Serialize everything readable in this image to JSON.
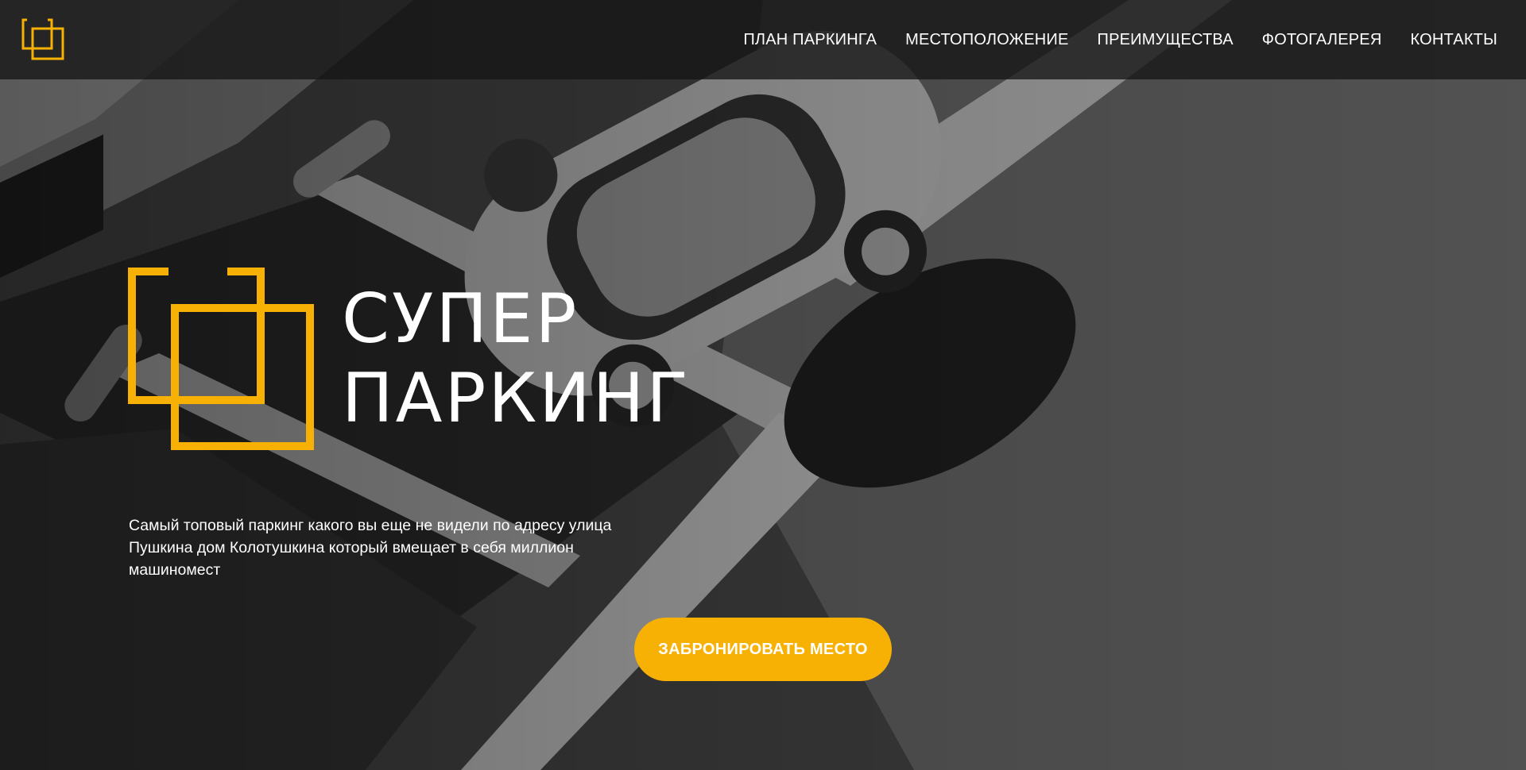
{
  "colors": {
    "accent": "#f7b105",
    "text": "#ffffff",
    "header_bg": "#161616"
  },
  "header": {
    "logo_icon": "overlapping-squares-logo-icon",
    "nav": [
      {
        "label": "ПЛАН ПАРКИНГА"
      },
      {
        "label": "МЕСТОПОЛОЖЕНИЕ"
      },
      {
        "label": "ПРЕИМУЩЕСТВА"
      },
      {
        "label": "ФОТОГАЛЕРЕЯ"
      },
      {
        "label": "КОНТАКТЫ"
      }
    ]
  },
  "hero": {
    "title_line1": "СУПЕР",
    "title_line2": "ПАРКИНГ",
    "description": "Самый топовый паркинг какого вы еще не видели по адресу улица Пушкина дом Колотушкина который вмещает в себя миллион машиномест",
    "cta_label": "ЗАБРОНИРОВАТЬ МЕСТО"
  }
}
